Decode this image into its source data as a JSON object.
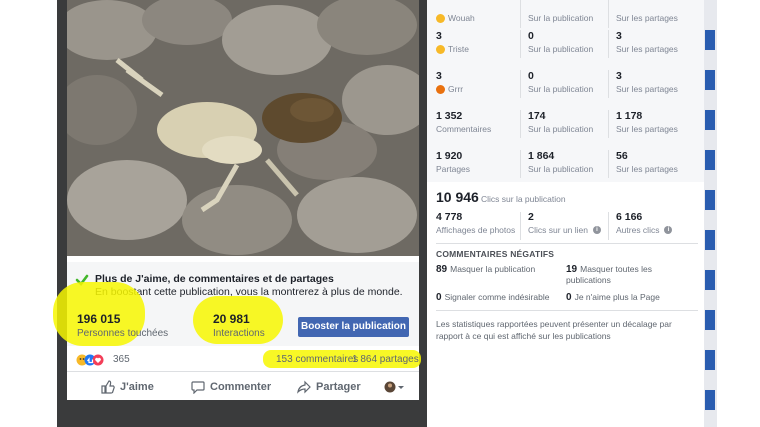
{
  "post": {
    "boost": {
      "title": "Plus de J'aime, de commentaires et de partages",
      "subtitle": "En boostant cette publication, vous la montrerez à plus de monde.",
      "reach_value": "196 015",
      "reach_label": "Personnes touchées",
      "engagement_value": "20 981",
      "engagement_label": "Interactions",
      "button_label": "Booster la publication"
    },
    "reactions_count": "365",
    "comments_text": "153 commentaires",
    "shares_text": "1 864 partages",
    "actions": {
      "like": "J'aime",
      "comment": "Commenter",
      "share": "Partager"
    }
  },
  "stats": {
    "rows": [
      {
        "c1_value": "",
        "c1_label": "Wouah",
        "c1_emoji": "wow",
        "c2_value": "",
        "c2_label": "Sur la publication",
        "c3_value": "",
        "c3_label": "Sur les partages"
      },
      {
        "c1_value": "3",
        "c1_label": "Triste",
        "c1_emoji": "sad",
        "c2_value": "0",
        "c2_label": "Sur la publication",
        "c3_value": "3",
        "c3_label": "Sur les partages"
      },
      {
        "c1_value": "3",
        "c1_label": "Grrr",
        "c1_emoji": "angry",
        "c2_value": "0",
        "c2_label": "Sur la publication",
        "c3_value": "3",
        "c3_label": "Sur les partages"
      },
      {
        "c1_value": "1 352",
        "c1_label": "Commentaires",
        "c2_value": "174",
        "c2_label": "Sur la publication",
        "c3_value": "1 178",
        "c3_label": "Sur les partages"
      },
      {
        "c1_value": "1 920",
        "c1_label": "Partages",
        "c2_value": "1 864",
        "c2_label": "Sur la publication",
        "c3_value": "56",
        "c3_label": "Sur les partages"
      }
    ],
    "clicks": {
      "total": "10 946",
      "total_label": "Clics sur la publication",
      "photo_value": "4 778",
      "photo_label": "Affichages de photos",
      "link_value": "2",
      "link_label": "Clics sur un lien",
      "other_value": "6 166",
      "other_label": "Autres clics"
    },
    "negative": {
      "title": "COMMENTAIRES NÉGATIFS",
      "hide_post_value": "89",
      "hide_post_label": "Masquer la publication",
      "hide_all_value": "19",
      "hide_all_label": "Masquer toutes les publications",
      "spam_value": "0",
      "spam_label": "Signaler comme indésirable",
      "unlike_value": "0",
      "unlike_label": "Je n'aime plus la Page"
    },
    "note": "Les statistiques rapportées peuvent présenter un décalage par rapport à ce qui est affiché sur les publications"
  },
  "colors": {
    "accent": "#4267b2",
    "highlight": "#f7f700",
    "check": "#42b72a"
  },
  "icons": [
    "check-icon",
    "like-icon",
    "comment-icon",
    "share-icon",
    "info-icon",
    "avatar-dropdown-icon"
  ]
}
